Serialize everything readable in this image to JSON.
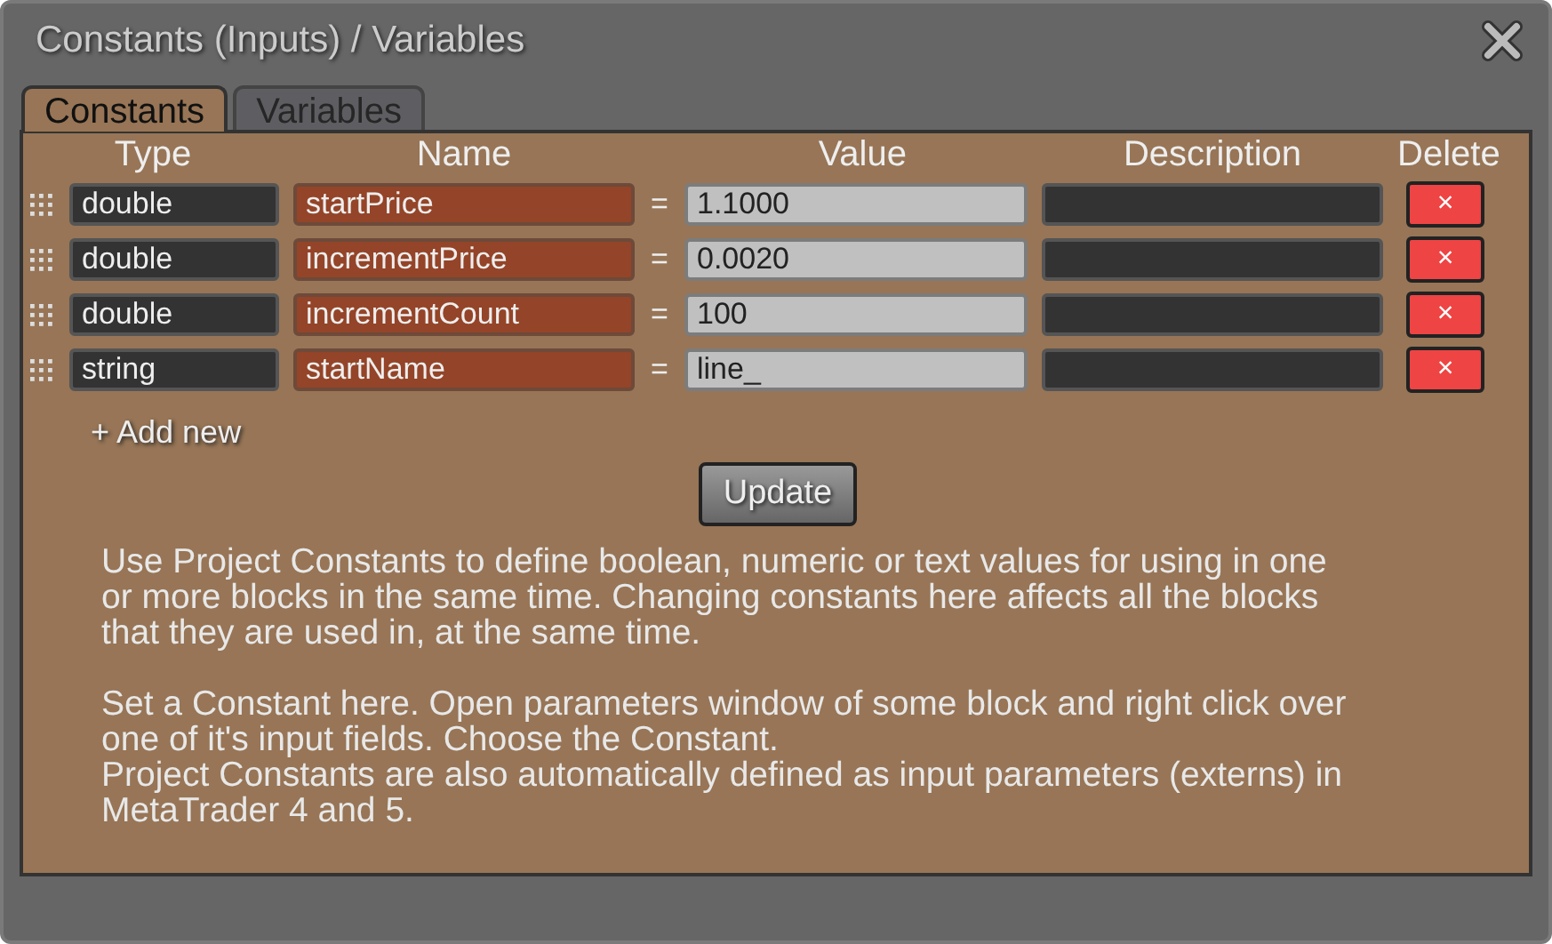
{
  "window": {
    "title": "Constants (Inputs) / Variables"
  },
  "tabs": [
    {
      "label": "Constants",
      "selected": true
    },
    {
      "label": "Variables",
      "selected": false
    }
  ],
  "table": {
    "columns": [
      "Type",
      "Name",
      "Value",
      "Description",
      "Delete"
    ],
    "rows": [
      {
        "type": "double",
        "name": "startPrice",
        "equals": "=",
        "value": "1.1000",
        "delete": "×"
      },
      {
        "type": "double",
        "name": "incrementPrice",
        "equals": "=",
        "value": "0.0020",
        "delete": "×"
      },
      {
        "type": "double",
        "name": "incrementCount",
        "equals": "=",
        "value": "100",
        "delete": "×"
      },
      {
        "type": "string",
        "name": "startName",
        "equals": "=",
        "value": "line_",
        "delete": "×"
      }
    ]
  },
  "add_new": "+ Add new",
  "update_button": "Update",
  "help_paragraphs": [
    "Use Project Constants to define boolean, numeric or text values for using in one or more blocks in the same time. Changing constants here affects all the blocks that they are used in, at the same time.",
    "Set a Constant here. Open parameters window of some block and right click over one of it's input fields. Choose the Constant.",
    "Project Constants are also automatically defined as input parameters (externs) in MetaTrader 4 and 5."
  ]
}
